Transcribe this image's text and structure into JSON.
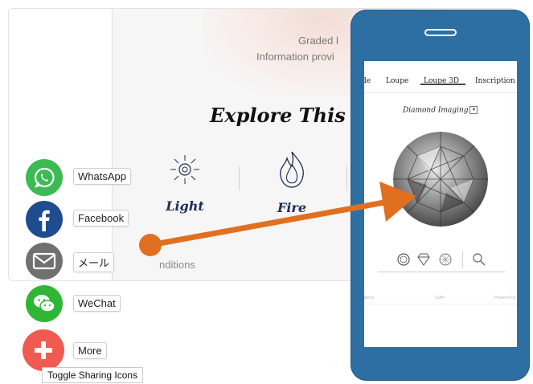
{
  "background_page": {
    "hero_line1": "Graded l",
    "hero_line2": "Information provi",
    "heading": "Explore This Di",
    "features": [
      {
        "label": "Light",
        "icon": "sun-icon"
      },
      {
        "label": "Fire",
        "icon": "flame-icon"
      }
    ],
    "conditions_label": "nditions"
  },
  "share_bar": {
    "items": [
      {
        "label": "WhatsApp",
        "icon": "whatsapp-icon",
        "color": "#3cba54"
      },
      {
        "label": "Facebook",
        "icon": "facebook-icon",
        "color": "#1f4b8f"
      },
      {
        "label": "メール",
        "icon": "mail-icon",
        "color": "#707070"
      },
      {
        "label": "WeChat",
        "icon": "wechat-icon",
        "color": "#30b636"
      },
      {
        "label": "More",
        "icon": "plus-icon",
        "color": "#f05a50"
      }
    ],
    "tooltip": "Toggle Sharing Icons"
  },
  "phone": {
    "frame_color": "#2e6fa3",
    "tabs": [
      "de",
      "Loupe",
      "Loupe 3D",
      "Inscription"
    ],
    "active_tab": "Loupe 3D",
    "diamond_title": "Diamond Imaging",
    "dropdown_glyph": "▾",
    "controls": [
      "round-outline-icon",
      "diamond-outline-icon",
      "facet-pattern-icon",
      "magnifier-icon"
    ],
    "footer_left": "ditions",
    "footer_mid": "GIA®",
    "footer_right": "Powered by"
  },
  "annotation_arrow": {
    "color": "#e07020"
  }
}
